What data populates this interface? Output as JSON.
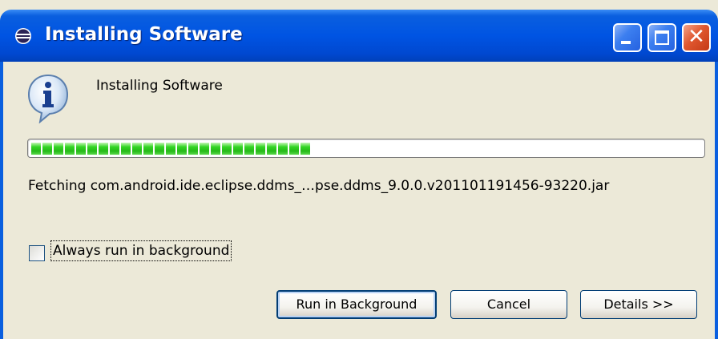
{
  "window": {
    "title": "Installing Software",
    "minimize_label": "_",
    "maximize_label": "□",
    "close_label": "✕"
  },
  "dialog": {
    "header": "Installing Software",
    "progress_fraction": 0.42,
    "status": "Fetching com.android.ide.eclipse.ddms_…pse.ddms_9.0.0.v201101191456-93220.jar",
    "checkbox": {
      "label": "Always run in background",
      "checked": false
    },
    "buttons": {
      "run_in_background": "Run in Background",
      "cancel": "Cancel",
      "details": "Details >>"
    }
  },
  "colors": {
    "titlebar": "#0054e3",
    "progress_green": "#25b918",
    "dialog_bg": "#ece9d8"
  }
}
